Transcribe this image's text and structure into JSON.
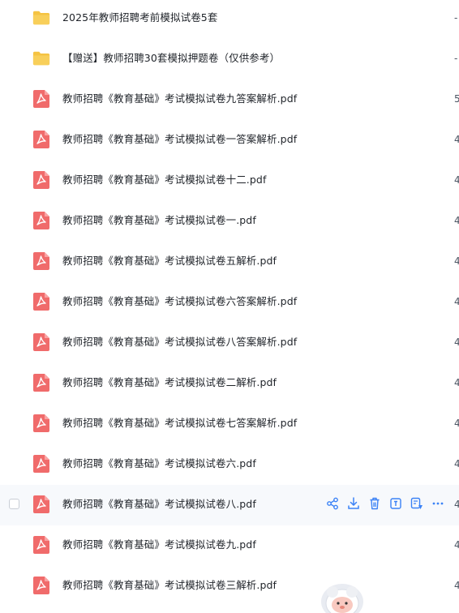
{
  "files": [
    {
      "name": "2025年教师招聘考前模拟试卷5套",
      "type": "folder",
      "size": "-"
    },
    {
      "name": "【赠送】教师招聘30套模拟押题卷（仅供参考）",
      "type": "folder",
      "size": "-"
    },
    {
      "name": "教师招聘《教育基础》考试模拟试卷九答案解析.pdf",
      "type": "pdf",
      "size": "5"
    },
    {
      "name": "教师招聘《教育基础》考试模拟试卷一答案解析.pdf",
      "type": "pdf",
      "size": "4"
    },
    {
      "name": "教师招聘《教育基础》考试模拟试卷十二.pdf",
      "type": "pdf",
      "size": "4"
    },
    {
      "name": "教师招聘《教育基础》考试模拟试卷一.pdf",
      "type": "pdf",
      "size": "4"
    },
    {
      "name": "教师招聘《教育基础》考试模拟试卷五解析.pdf",
      "type": "pdf",
      "size": "4"
    },
    {
      "name": "教师招聘《教育基础》考试模拟试卷六答案解析.pdf",
      "type": "pdf",
      "size": "4"
    },
    {
      "name": "教师招聘《教育基础》考试模拟试卷八答案解析.pdf",
      "type": "pdf",
      "size": "4"
    },
    {
      "name": "教师招聘《教育基础》考试模拟试卷二解析.pdf",
      "type": "pdf",
      "size": "4"
    },
    {
      "name": "教师招聘《教育基础》考试模拟试卷七答案解析.pdf",
      "type": "pdf",
      "size": "4"
    },
    {
      "name": "教师招聘《教育基础》考试模拟试卷六.pdf",
      "type": "pdf",
      "size": "4"
    },
    {
      "name": "教师招聘《教育基础》考试模拟试卷八.pdf",
      "type": "pdf",
      "size": "4",
      "hovered": true
    },
    {
      "name": "教师招聘《教育基础》考试模拟试卷九.pdf",
      "type": "pdf",
      "size": "4"
    },
    {
      "name": "教师招聘《教育基础》考试模拟试卷三解析.pdf",
      "type": "pdf",
      "size": "4"
    }
  ],
  "row_actions": [
    "share-icon",
    "download-icon",
    "delete-icon",
    "rename-icon",
    "ai-assistant-icon",
    "more-icon"
  ],
  "colors": {
    "folder": "#f5c342",
    "pdf": "#f06b6b",
    "action": "#3b82f6",
    "hover_row": "#f7f9fc"
  }
}
